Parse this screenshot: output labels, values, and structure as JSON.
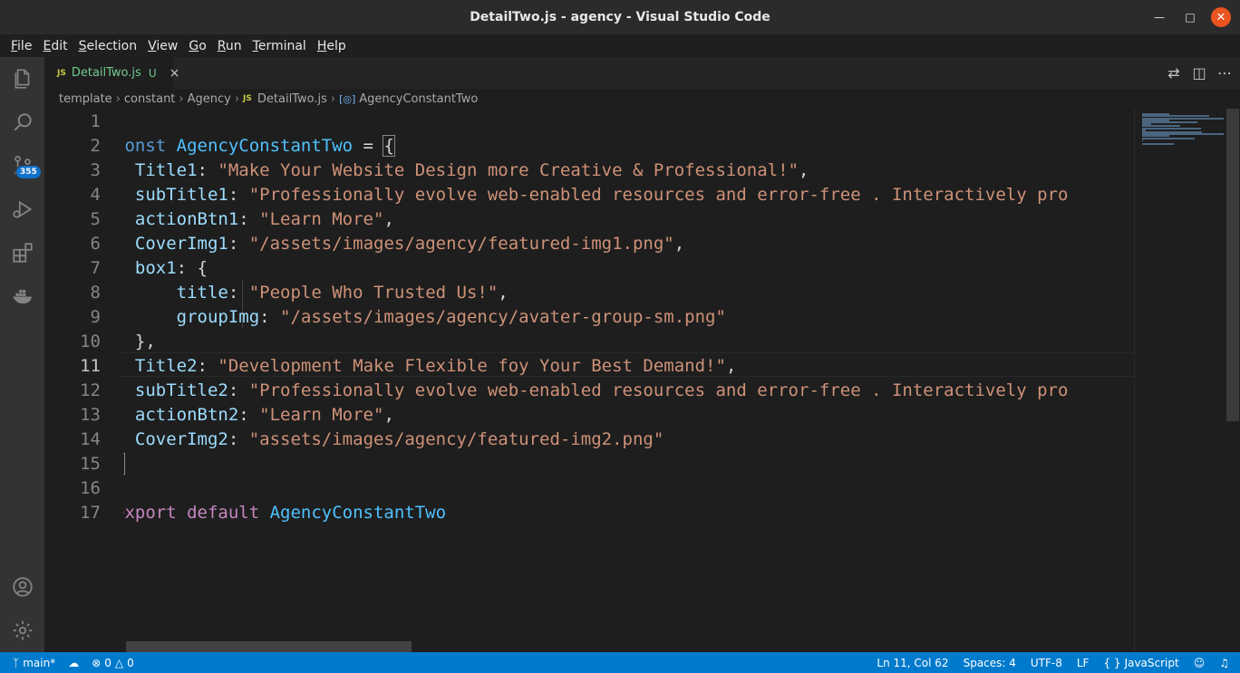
{
  "window": {
    "title": "DetailTwo.js - agency - Visual Studio Code"
  },
  "menu": [
    {
      "label": "File",
      "m": "F",
      "rest": "ile"
    },
    {
      "label": "Edit",
      "m": "E",
      "rest": "dit"
    },
    {
      "label": "Selection",
      "m": "S",
      "rest": "election"
    },
    {
      "label": "View",
      "m": "V",
      "rest": "iew"
    },
    {
      "label": "Go",
      "m": "G",
      "rest": "o"
    },
    {
      "label": "Run",
      "m": "R",
      "rest": "un"
    },
    {
      "label": "Terminal",
      "m": "T",
      "rest": "erminal"
    },
    {
      "label": "Help",
      "m": "H",
      "rest": "elp"
    }
  ],
  "activity": {
    "items": [
      "explorer-icon",
      "search-icon",
      "source-control-icon",
      "run-debug-icon",
      "extensions-icon",
      "docker-icon",
      "account-icon",
      "manage-gear-icon"
    ],
    "scm_badge": "355"
  },
  "tab": {
    "lang": "JS",
    "filename": "DetailTwo.js",
    "status": "U",
    "close": "×"
  },
  "breadcrumb": {
    "parts": [
      "template",
      "constant",
      "Agency"
    ],
    "file_lang": "JS",
    "file": "DetailTwo.js",
    "symbol_icon": "[◎]",
    "symbol": "AgencyConstantTwo"
  },
  "editor": {
    "active_line": 11,
    "line_numbers": [
      "1",
      "2",
      "3",
      "4",
      "5",
      "6",
      "7",
      "8",
      "9",
      "10",
      "11",
      "12",
      "13",
      "14",
      "15",
      "16",
      "17"
    ],
    "lines": [
      [],
      [
        [
          "kw",
          "const "
        ],
        [
          "cn",
          "AgencyConstantTwo"
        ],
        [
          "pun",
          " = "
        ],
        [
          "brk",
          "{"
        ]
      ],
      [
        [
          "pun",
          "  "
        ],
        [
          "prop",
          "Title1"
        ],
        [
          "pun",
          ": "
        ],
        [
          "str",
          "\"Make Your Website Design more Creative & Professional!\""
        ],
        [
          "pun",
          ","
        ]
      ],
      [
        [
          "pun",
          "  "
        ],
        [
          "prop",
          "subTitle1"
        ],
        [
          "pun",
          ": "
        ],
        [
          "str",
          "\"Professionally evolve web-enabled resources and error-free . Interactively pro"
        ]
      ],
      [
        [
          "pun",
          "  "
        ],
        [
          "prop",
          "actionBtn1"
        ],
        [
          "pun",
          ": "
        ],
        [
          "str",
          "\"Learn More\""
        ],
        [
          "pun",
          ","
        ]
      ],
      [
        [
          "pun",
          "  "
        ],
        [
          "prop",
          "CoverImg1"
        ],
        [
          "pun",
          ": "
        ],
        [
          "str",
          "\"/assets/images/agency/featured-img1.png\""
        ],
        [
          "pun",
          ","
        ]
      ],
      [
        [
          "pun",
          "  "
        ],
        [
          "prop",
          "box1"
        ],
        [
          "pun",
          ": {"
        ]
      ],
      [
        [
          "pun",
          "      "
        ],
        [
          "prop",
          "title"
        ],
        [
          "pun",
          ": "
        ],
        [
          "str",
          "\"People Who Trusted Us!\""
        ],
        [
          "pun",
          ","
        ]
      ],
      [
        [
          "pun",
          "      "
        ],
        [
          "prop",
          "groupImg"
        ],
        [
          "pun",
          ": "
        ],
        [
          "str",
          "\"/assets/images/agency/avater-group-sm.png\""
        ]
      ],
      [
        [
          "pun",
          "  },"
        ]
      ],
      [
        [
          "pun",
          "  "
        ],
        [
          "prop",
          "Title2"
        ],
        [
          "pun",
          ": "
        ],
        [
          "str",
          "\"Development Make Flexible foy Your Best Demand!\""
        ],
        [
          "pun",
          ","
        ]
      ],
      [
        [
          "pun",
          "  "
        ],
        [
          "prop",
          "subTitle2"
        ],
        [
          "pun",
          ": "
        ],
        [
          "str",
          "\"Professionally evolve web-enabled resources and error-free . Interactively pro"
        ]
      ],
      [
        [
          "pun",
          "  "
        ],
        [
          "prop",
          "actionBtn2"
        ],
        [
          "pun",
          ": "
        ],
        [
          "str",
          "\"Learn More\""
        ],
        [
          "pun",
          ","
        ]
      ],
      [
        [
          "pun",
          "  "
        ],
        [
          "prop",
          "CoverImg2"
        ],
        [
          "pun",
          ": "
        ],
        [
          "str",
          "\"assets/images/agency/featured-img2.png\""
        ]
      ],
      [
        [
          "brk",
          "}"
        ]
      ],
      [],
      [
        [
          "kw2",
          "export "
        ],
        [
          "kw2",
          "default "
        ],
        [
          "cn",
          "AgencyConstantTwo"
        ]
      ]
    ]
  },
  "status": {
    "branch": "main*",
    "errors": "0",
    "warnings": "0",
    "position": "Ln 11, Col 62",
    "spaces": "Spaces: 4",
    "encoding": "UTF-8",
    "eol": "LF",
    "language": "JavaScript"
  },
  "colors": {
    "statusbar": "#007acc",
    "keyword": "#569cd6",
    "string": "#ce9178",
    "property": "#9cdcfe",
    "constant": "#4fc1ff",
    "control": "#c586c0"
  }
}
